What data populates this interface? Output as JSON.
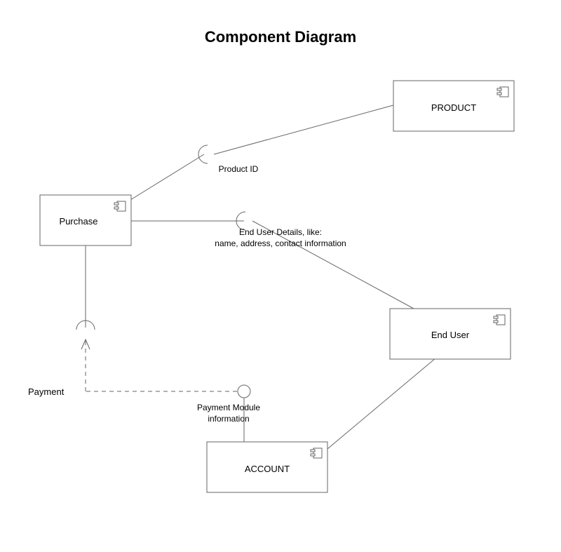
{
  "title": "Component Diagram",
  "components": {
    "product": "PRODUCT",
    "purchase": "Purchase",
    "end_user": "End User",
    "account": "ACCOUNT"
  },
  "interfaces": {
    "product_id": "Product ID",
    "end_user_details_l1": "End User Details, like:",
    "end_user_details_l2": "name, address, contact information",
    "payment": "Payment",
    "payment_module_l1": "Payment Module",
    "payment_module_l2": "information"
  }
}
